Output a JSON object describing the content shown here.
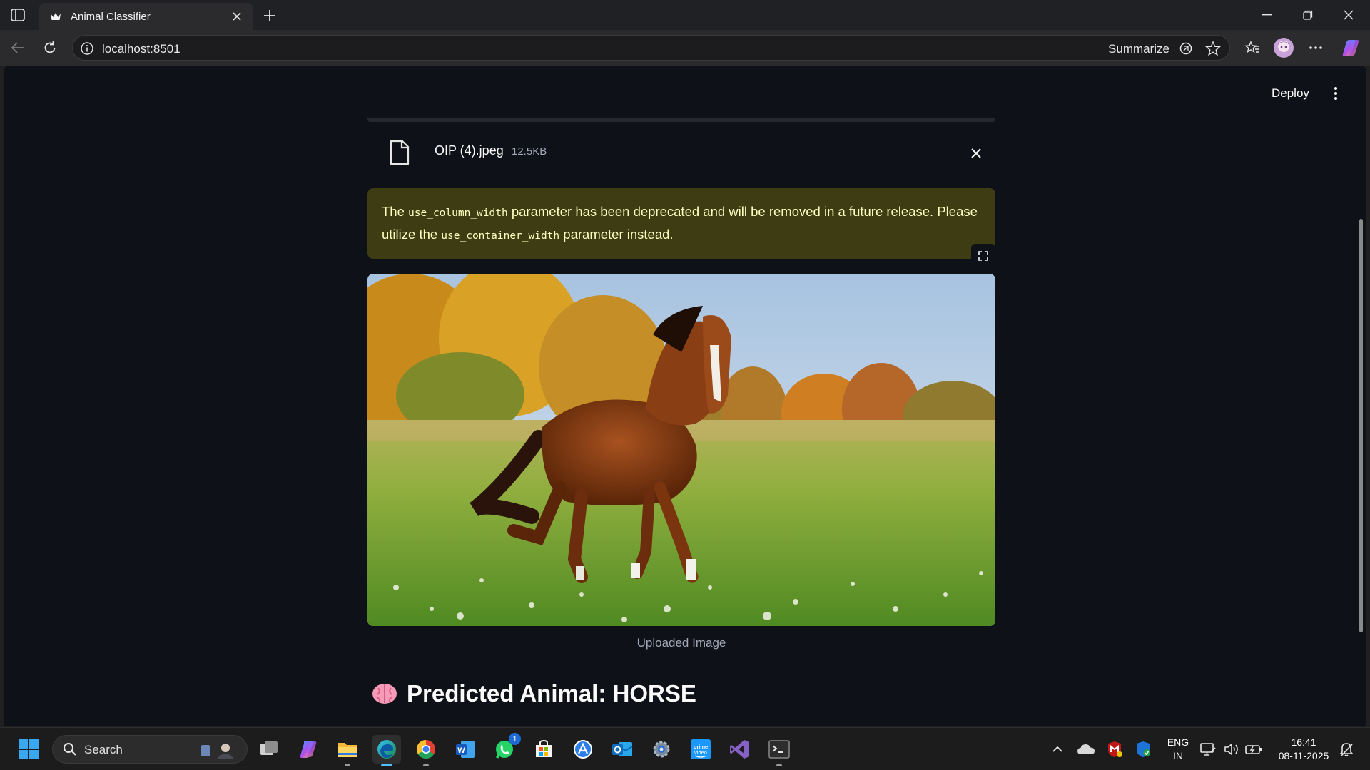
{
  "browser": {
    "tab_title": "Animal Classifier",
    "url": "localhost:8501",
    "summarize_label": "Summarize"
  },
  "app": {
    "deploy_label": "Deploy",
    "file": {
      "name": "OIP (4).jpeg",
      "size": "12.5KB"
    },
    "warning": {
      "part1": "The ",
      "code1": "use_column_width",
      "part2": " parameter has been deprecated and will be removed in a future release. Please utilize the ",
      "code2": "use_container_width",
      "part3": " parameter instead."
    },
    "image_caption": "Uploaded Image",
    "prediction_text": "Predicted Animal: HORSE"
  },
  "taskbar": {
    "search_label": "Search",
    "whatsapp_badge": "1",
    "language_line1": "ENG",
    "language_line2": "IN",
    "time": "16:41",
    "date": "08-11-2025"
  },
  "colors": {
    "page_bg": "#0e1117",
    "warning_bg": "#3d3c13",
    "warning_text": "#ffffc2",
    "accent_taskbar": "#4cc2ff"
  }
}
